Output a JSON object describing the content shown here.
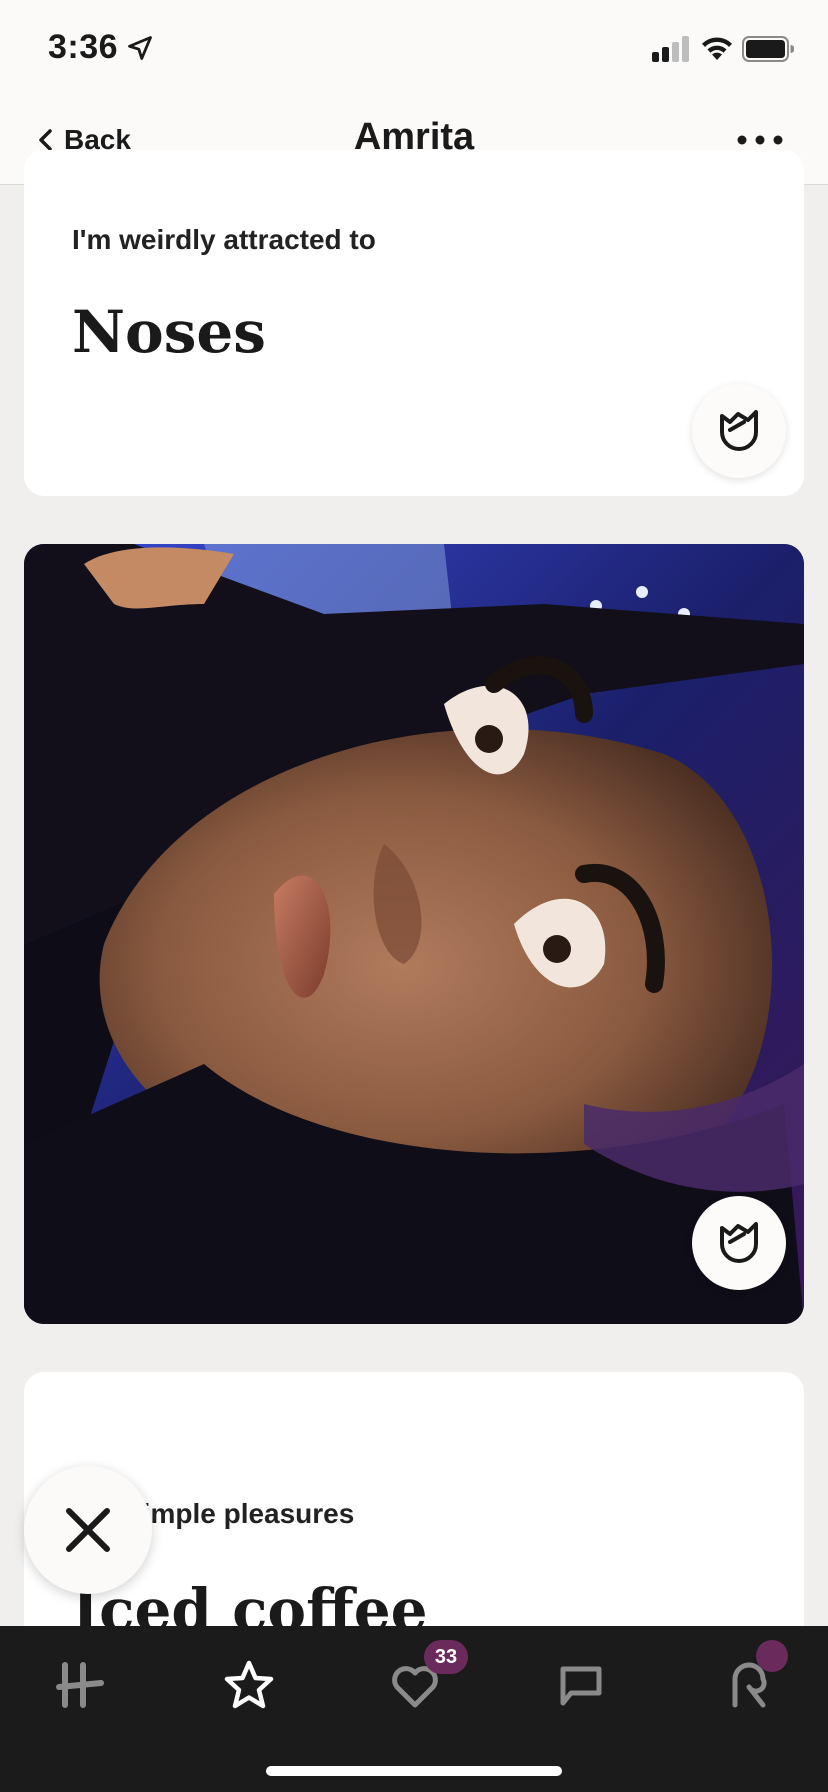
{
  "status_bar": {
    "time": "3:36",
    "icons": [
      "location-arrow-icon",
      "cellular-signal-icon",
      "wifi-icon",
      "battery-icon"
    ]
  },
  "nav": {
    "back_label": "Back",
    "title": "Amrita",
    "more_icon": "ellipsis-icon"
  },
  "prompts": [
    {
      "question": "I'm weirdly attracted to",
      "answer": "Noses"
    },
    {
      "question": "Simple pleasures",
      "answer": "Iced coffee"
    }
  ],
  "photo": {
    "description_icon": "profile-photo"
  },
  "tab_bar": {
    "tabs": [
      {
        "name": "home",
        "icon": "hinge-logo-icon"
      },
      {
        "name": "standouts",
        "icon": "star-icon"
      },
      {
        "name": "likes",
        "icon": "heart-check-icon"
      },
      {
        "name": "matches",
        "icon": "chat-bubble-icon"
      },
      {
        "name": "profile",
        "icon": "person-icon"
      }
    ],
    "likes_badge": "33"
  },
  "colors": {
    "accent": "#6b2a5c",
    "background": "#f0efee",
    "tab_bar": "#1b1b1b"
  }
}
